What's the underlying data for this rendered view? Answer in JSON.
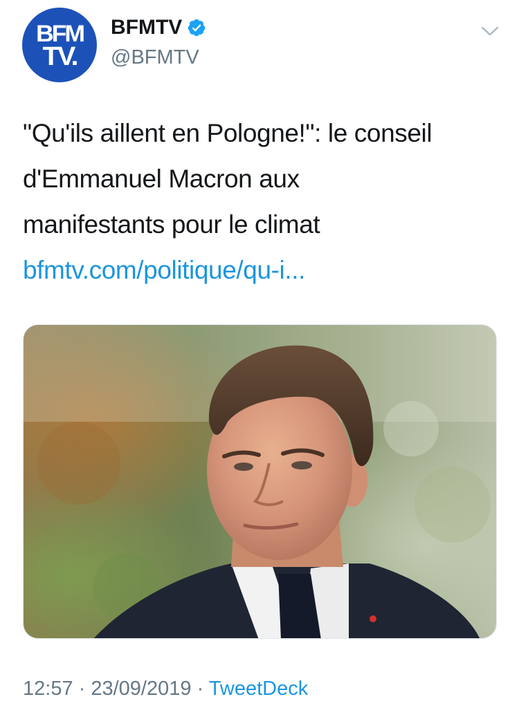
{
  "author": {
    "avatar_text_line1": "BFM",
    "avatar_text_line2": "TV.",
    "display_name": "BFMTV",
    "handle": "@BFMTV",
    "verified": true,
    "avatar_color": "#1c52b8"
  },
  "tweet": {
    "text_lines": [
      "\"Qu'ils aillent en Pologne!\": le conseil",
      "d'Emmanuel Macron aux",
      "manifestants pour le climat"
    ],
    "link_text": "bfmtv.com/politique/qu-i..."
  },
  "media": {
    "type": "photo"
  },
  "footer": {
    "time": "12:57",
    "separator": " · ",
    "date": "23/09/2019",
    "source": "TweetDeck"
  },
  "colors": {
    "link": "#1b95e0",
    "muted": "#657786",
    "text": "#14171a",
    "verified": "#1da1f2"
  },
  "icons": {
    "verified": "verified-badge-icon",
    "menu": "chevron-down-icon"
  }
}
